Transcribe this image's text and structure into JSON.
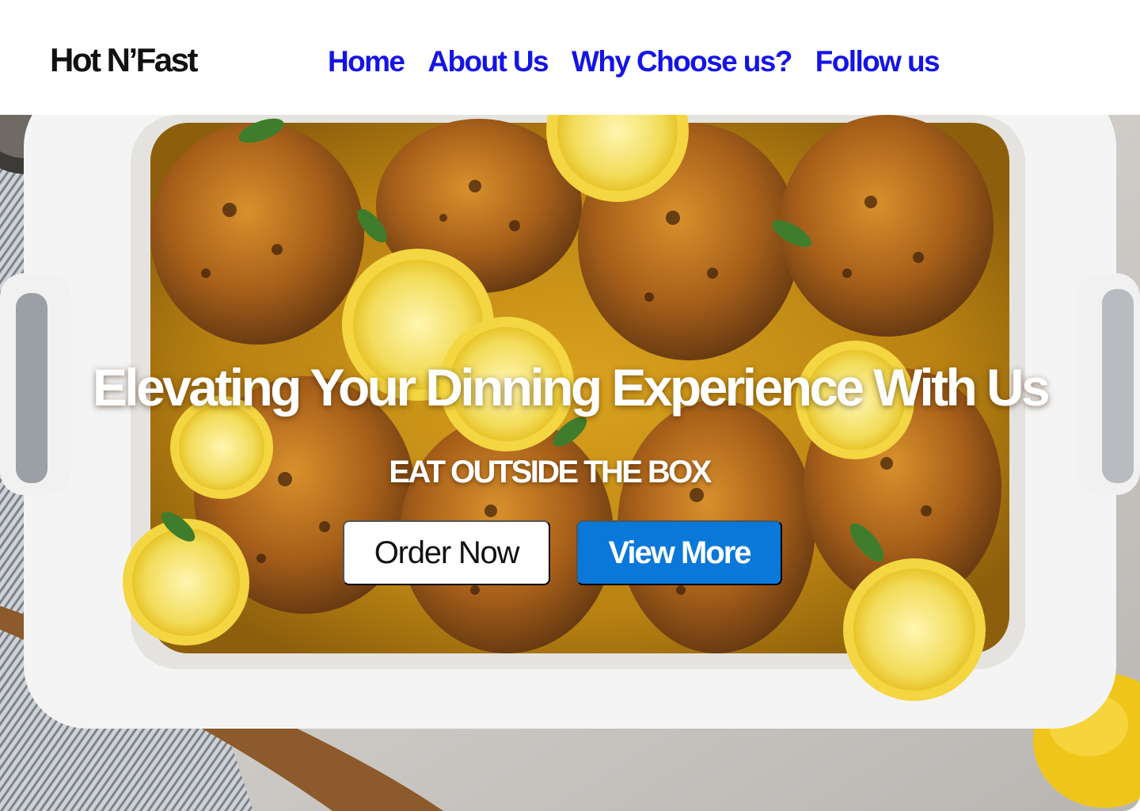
{
  "header": {
    "logo": "Hot N’Fast",
    "nav": [
      {
        "label": "Home"
      },
      {
        "label": "About Us"
      },
      {
        "label": "Why Choose us?"
      },
      {
        "label": "Follow us"
      }
    ]
  },
  "hero": {
    "image": "roasted-lemon-herb-chicken-thighs-in-baking-dish",
    "headline": "Elevating  Your Dinning Experience With Us",
    "tagline": "EAT OUTSIDE THE BOX",
    "order_button": "Order Now",
    "view_button": "View More"
  },
  "colors": {
    "nav_link": "#1414e6",
    "logo": "#111111",
    "view_button_bg": "#0a78d8",
    "order_button_bg": "#ffffff"
  }
}
